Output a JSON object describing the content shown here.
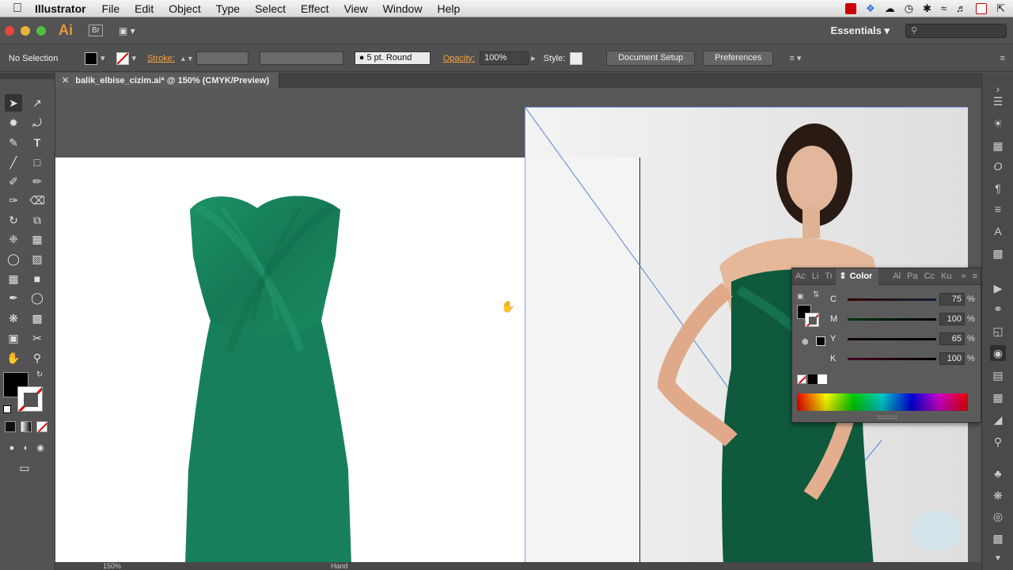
{
  "menubar": {
    "app_name": "Illustrator",
    "items": [
      "File",
      "Edit",
      "Object",
      "Type",
      "Select",
      "Effect",
      "View",
      "Window",
      "Help"
    ]
  },
  "appbar": {
    "logo": "Ai",
    "bridge": "Br",
    "workspace": "Essentials"
  },
  "control": {
    "selection": "No Selection",
    "stroke_label": "Stroke:",
    "brush": "5 pt. Round",
    "opacity_label": "Opacity:",
    "opacity_value": "100%",
    "style_label": "Style:",
    "document_setup": "Document Setup",
    "preferences": "Preferences"
  },
  "document": {
    "tab_title": "balik_elbise_cizim.ai* @ 150% (CMYK/Preview)"
  },
  "color_panel": {
    "tabs": [
      "Ac",
      "Li",
      "Tr",
      "Color",
      "Al",
      "Pa",
      "Cc",
      "Ku"
    ],
    "active_tab": "Color",
    "channels": [
      {
        "label": "C",
        "value": "75",
        "unit": "%"
      },
      {
        "label": "M",
        "value": "100",
        "unit": "%"
      },
      {
        "label": "Y",
        "value": "65",
        "unit": "%"
      },
      {
        "label": "K",
        "value": "100",
        "unit": "%"
      }
    ]
  },
  "colors": {
    "dress_green": "#17805a",
    "accent_orange": "#f3a23d"
  },
  "status": {
    "zoom": "150%",
    "tool": "Hand"
  }
}
